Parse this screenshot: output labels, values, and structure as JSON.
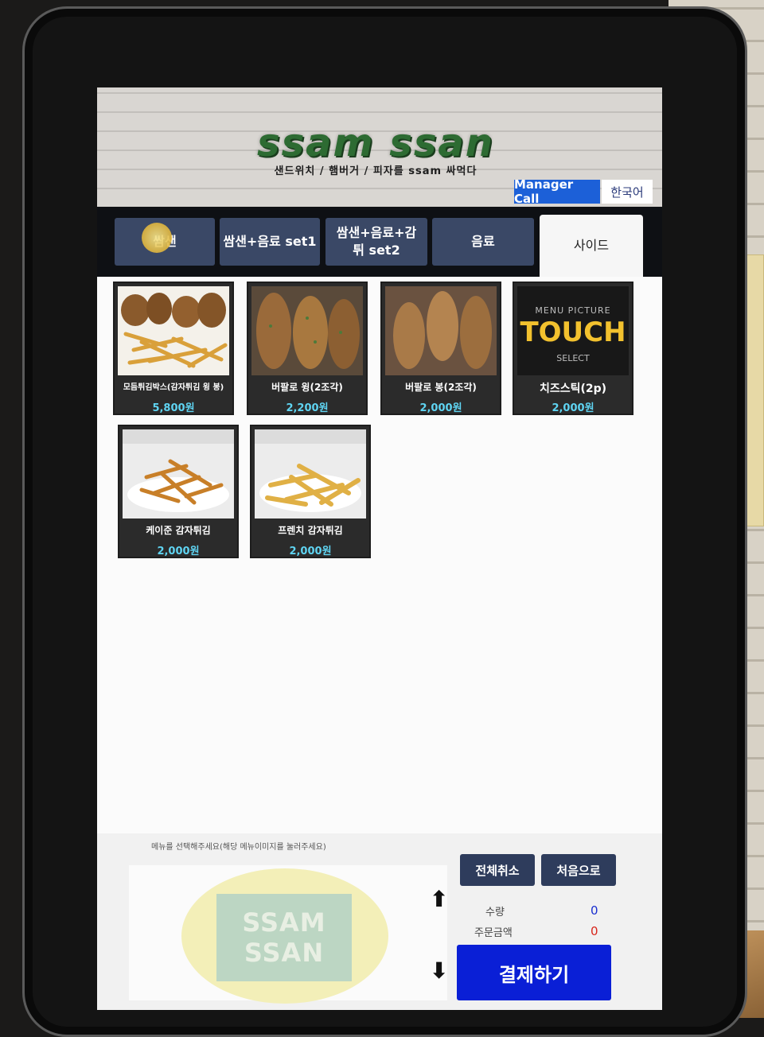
{
  "header": {
    "brand": "ssam ssan",
    "tagline": "샌드위치 / 햄버거 / 피자를 ssam 싸먹다",
    "manager_call": "Manager Call",
    "language": "한국어"
  },
  "tabs": [
    {
      "label": "쌈샌"
    },
    {
      "label": "쌈샌+음료 set1"
    },
    {
      "label": "쌈샌+음료+감튀 set2"
    },
    {
      "label": "음료"
    },
    {
      "label": "사이드"
    }
  ],
  "products": [
    {
      "name": "모듬튀김박스(감자튀김 윙 봉)",
      "price": "5,800원"
    },
    {
      "name": "버팔로 윙(2조각)",
      "price": "2,200원"
    },
    {
      "name": "버팔로 봉(2조각)",
      "price": "2,000원"
    },
    {
      "name": "치즈스틱(2p)",
      "price": "2,000원",
      "placeholder": {
        "top": "MENU PICTURE",
        "main": "TOUCH",
        "bottom": "SELECT"
      }
    },
    {
      "name": "케이준 감자튀김",
      "price": "2,000원"
    },
    {
      "name": "프렌치 감자튀김",
      "price": "2,000원"
    }
  ],
  "bottom": {
    "hint": "메뉴를 선택해주세요(해당 메뉴이미지를 눌러주세요)",
    "watermark_line1": "SSAM",
    "watermark_line2": "SSAN",
    "cancel_all": "전체취소",
    "go_home": "처음으로",
    "qty_label": "수량",
    "qty_value": "0",
    "amount_label": "주문금액",
    "amount_value": "0",
    "pay": "결제하기",
    "up_arrow": "⬆",
    "down_arrow": "⬇"
  },
  "colors": {
    "tab": "#3a4866",
    "price": "#5fd4f2",
    "pay": "#0a1fd6",
    "manager": "#1c60d8",
    "qty": "#1a2fd0",
    "amount": "#d8261c"
  }
}
